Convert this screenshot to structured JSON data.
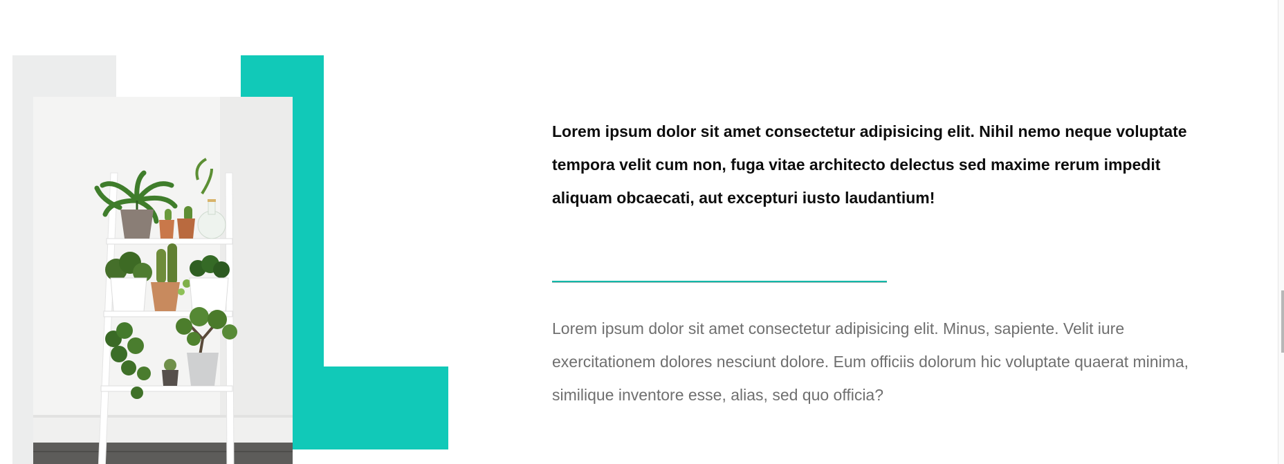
{
  "image": {
    "alt": "White ladder shelf with potted plants",
    "icon": "plant-shelf-photo"
  },
  "colors": {
    "accent": "#11c9b8",
    "gray_block": "#eceded",
    "lead_text": "#0d0d0d",
    "body_text": "#6f6f6f"
  },
  "content": {
    "lead": "Lorem ipsum dolor sit amet consectetur adipisicing elit. Nihil nemo neque voluptate tempora velit cum non, fuga vitae architecto delectus sed maxime rerum impedit aliquam obcaecati, aut excepturi iusto laudantium!",
    "body": "Lorem ipsum dolor sit amet consectetur adipisicing elit. Minus, sapiente. Velit iure exercitationem dolores nesciunt dolore. Eum officiis dolorum hic voluptate quaerat minima, similique inventore esse, alias, sed quo officia?"
  }
}
